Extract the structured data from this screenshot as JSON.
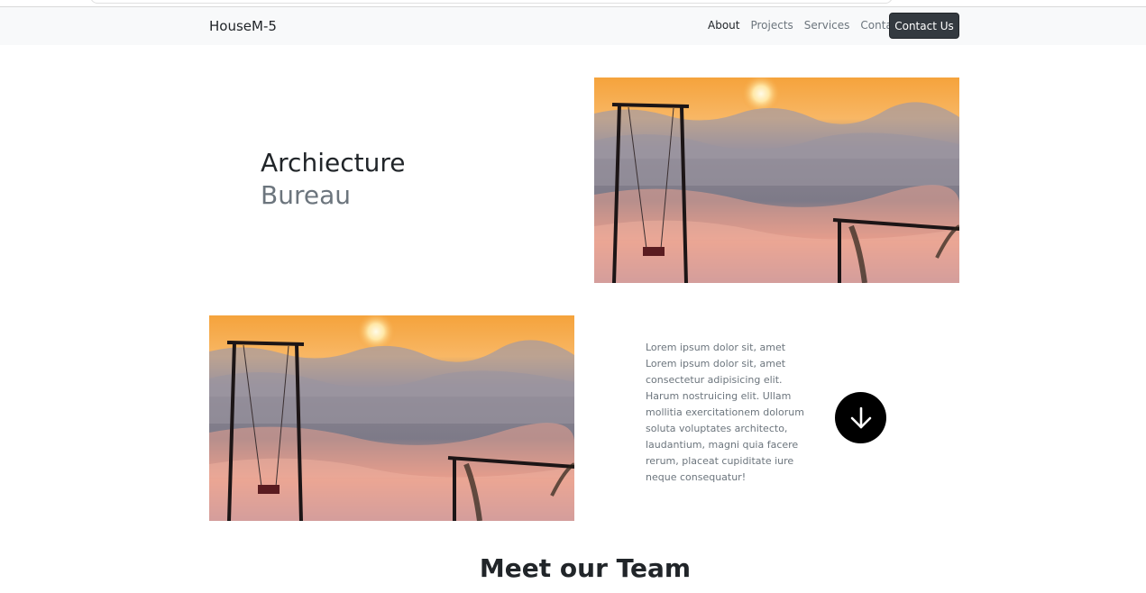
{
  "navbar": {
    "brand": "HouseM-5",
    "links": [
      {
        "label": "About"
      },
      {
        "label": "Projects"
      },
      {
        "label": "Services"
      },
      {
        "label": "Contact"
      }
    ],
    "cta_label": "Contact Us"
  },
  "hero": {
    "title_line1": "Archiecture",
    "title_line2": "Bureau"
  },
  "about": {
    "paragraph": "Lorem ipsum dolor sit, amet Lorem ipsum dolor sit, amet consectetur adipisicing elit. Harum nostruicing elit. Ullam mollitia exercitationem dolorum soluta voluptates architecto, laudantium, magni quia facere rerum, placeat cupiditate iure neque consequatur!",
    "scroll_icon": "arrow-down-icon"
  },
  "team": {
    "heading": "Meet our Team"
  },
  "colors": {
    "navbar_bg": "#f8f9fa",
    "button_dark": "#343a40",
    "muted_text": "#6c757d",
    "sky_orange": "#f3a24a"
  }
}
